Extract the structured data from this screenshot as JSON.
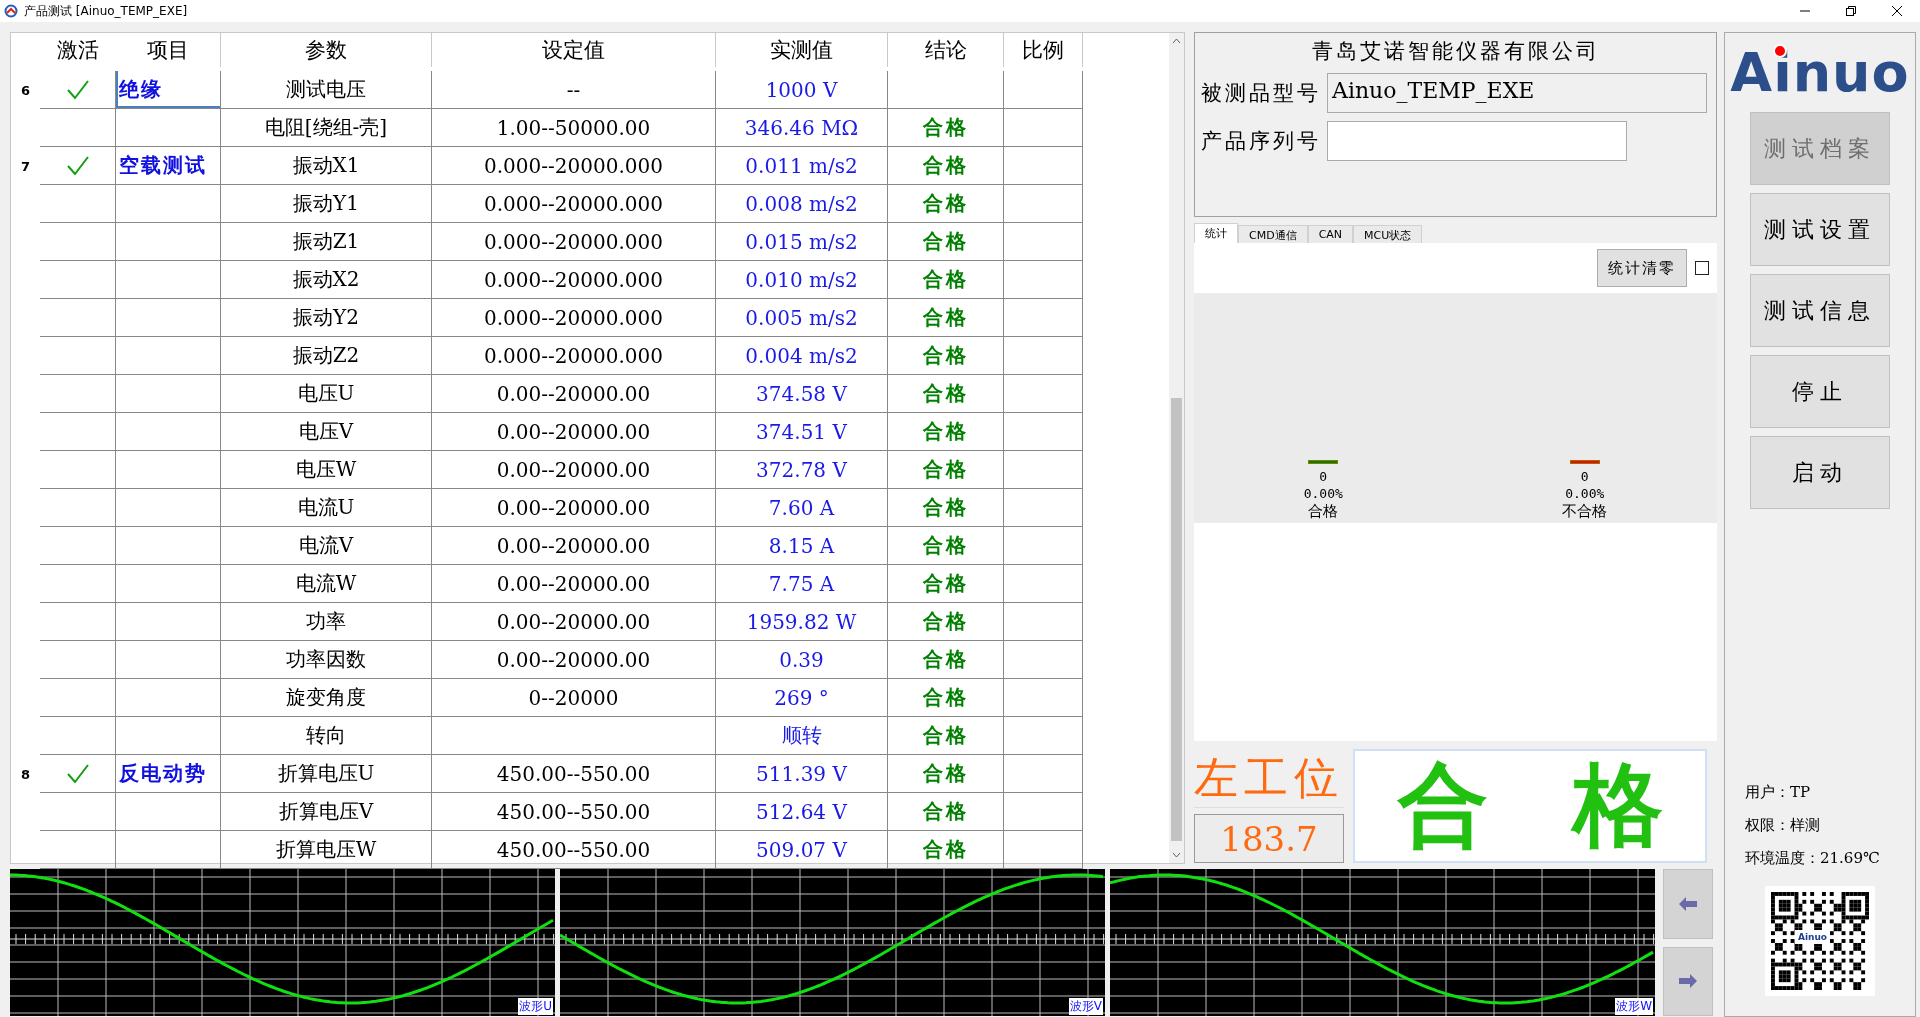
{
  "window": {
    "title": "产品测试 [Ainuo_TEMP_EXE]"
  },
  "table": {
    "columns": [
      "激活",
      "项目",
      "参数",
      "设定值",
      "实测值",
      "结论",
      "比例"
    ],
    "rows": [
      {
        "number": "6",
        "active": true,
        "selected": true,
        "item": "绝缘",
        "param": "测试电压",
        "set": "--",
        "measured": "1000 V"
      },
      {
        "param": "电阻[绕组-壳]",
        "set": "1.00--50000.00",
        "measured": "346.46 MΩ",
        "result": "合格"
      },
      {
        "number": "7",
        "active": true,
        "selected": false,
        "item": "空载测试",
        "param": "振动X1",
        "set": "0.000--20000.000",
        "measured": "0.011 m/s2",
        "result": "合格"
      },
      {
        "param": "振动Y1",
        "set": "0.000--20000.000",
        "measured": "0.008 m/s2",
        "result": "合格"
      },
      {
        "param": "振动Z1",
        "set": "0.000--20000.000",
        "measured": "0.015 m/s2",
        "result": "合格"
      },
      {
        "param": "振动X2",
        "set": "0.000--20000.000",
        "measured": "0.010 m/s2",
        "result": "合格"
      },
      {
        "param": "振动Y2",
        "set": "0.000--20000.000",
        "measured": "0.005 m/s2",
        "result": "合格"
      },
      {
        "param": "振动Z2",
        "set": "0.000--20000.000",
        "measured": "0.004 m/s2",
        "result": "合格"
      },
      {
        "param": "电压U",
        "set": "0.00--20000.00",
        "measured": "374.58 V",
        "result": "合格"
      },
      {
        "param": "电压V",
        "set": "0.00--20000.00",
        "measured": "374.51 V",
        "result": "合格"
      },
      {
        "param": "电压W",
        "set": "0.00--20000.00",
        "measured": "372.78 V",
        "result": "合格"
      },
      {
        "param": "电流U",
        "set": "0.00--20000.00",
        "measured": "7.60 A",
        "result": "合格"
      },
      {
        "param": "电流V",
        "set": "0.00--20000.00",
        "measured": "8.15 A",
        "result": "合格"
      },
      {
        "param": "电流W",
        "set": "0.00--20000.00",
        "measured": "7.75 A",
        "result": "合格"
      },
      {
        "param": "功率",
        "set": "0.00--20000.00",
        "measured": "1959.82 W",
        "result": "合格"
      },
      {
        "param": "功率因数",
        "set": "0.00--20000.00",
        "measured": "0.39",
        "result": "合格"
      },
      {
        "param": "旋变角度",
        "set": "0--20000",
        "measured": "269 °",
        "result": "合格"
      },
      {
        "param": "转向",
        "measured": "顺转",
        "result": "合格"
      },
      {
        "number": "8",
        "active": true,
        "selected": false,
        "item": "反电动势",
        "param": "折算电压U",
        "set": "450.00--550.00",
        "measured": "511.39 V",
        "result": "合格"
      },
      {
        "param": "折算电压V",
        "set": "450.00--550.00",
        "measured": "512.64 V",
        "result": "合格"
      },
      {
        "param": "折算电压W",
        "set": "450.00--550.00",
        "measured": "509.07 V",
        "result": "合格"
      }
    ]
  },
  "info": {
    "company": "青岛艾诺智能仪器有限公司",
    "fields": [
      {
        "label": "被测品型号",
        "value": "Ainuo_TEMP_EXE",
        "readonly": true
      },
      {
        "label": "产品序列号",
        "readonly": false
      }
    ]
  },
  "tabs": [
    {
      "label": "统计",
      "selected": true
    },
    {
      "label": "CMD通信",
      "selected": false
    },
    {
      "label": "CAN",
      "selected": false
    },
    {
      "label": "MCU状态",
      "selected": false
    }
  ],
  "stats": {
    "reset_button": "统计清零",
    "checked": false,
    "bars": [
      {
        "color": "#008000",
        "count": "0",
        "percent": "0.00%",
        "label": "合格"
      },
      {
        "color": "#ff0000",
        "count": "0",
        "percent": "0.00%",
        "label": "不合格"
      }
    ]
  },
  "station": {
    "label": "左工位",
    "value": "183.7"
  },
  "verdict": {
    "chars": [
      "合",
      "格"
    ],
    "passed": true
  },
  "waves": [
    {
      "label": "波形U"
    },
    {
      "label": "波形V"
    },
    {
      "label": "波形W"
    }
  ],
  "sidebar": {
    "logo": "Ainuo",
    "buttons": [
      {
        "label": "测试档案",
        "disabled": true
      },
      {
        "label": "测试设置",
        "disabled": false
      },
      {
        "label": "测试信息",
        "disabled": false
      },
      {
        "label": "停止",
        "disabled": false
      },
      {
        "label": "启动",
        "disabled": false
      }
    ],
    "info": [
      "用户：TP",
      "权限：样测",
      "环境温度：21.69℃"
    ],
    "qr_label": "Ainuo"
  }
}
